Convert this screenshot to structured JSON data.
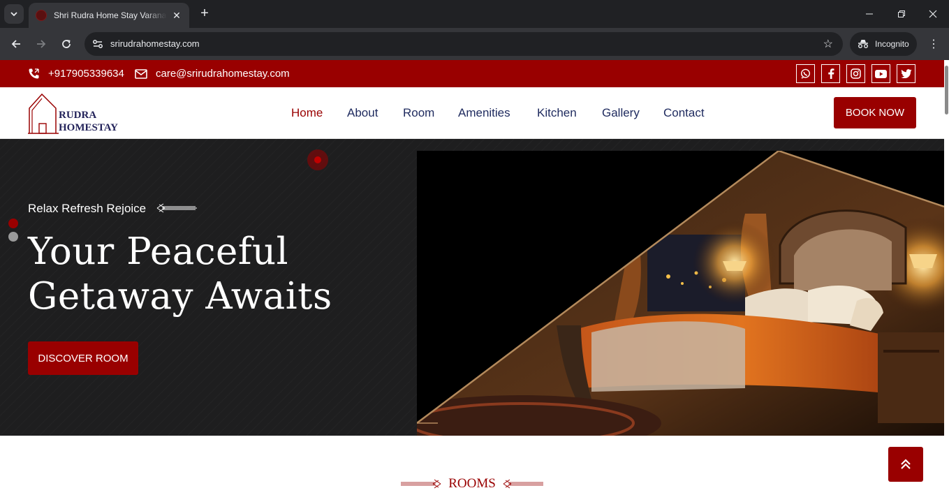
{
  "browser": {
    "tab_title": "Shri Rudra Home Stay Varanasi",
    "url": "srirudrahomestay.com",
    "incognito_label": "Incognito"
  },
  "topbar": {
    "phone": "+917905339634",
    "email": "care@srirudrahomestay.com",
    "social": [
      "whatsapp-icon",
      "facebook-icon",
      "instagram-icon",
      "youtube-icon",
      "twitter-icon"
    ]
  },
  "logo": {
    "line1": "RUDRA",
    "line2": "HOMESTAY"
  },
  "nav": {
    "items": [
      "Home",
      "About",
      "Room",
      "Amenities",
      "Kitchen",
      "Gallery",
      "Contact"
    ],
    "active": "Home",
    "book_label": "BOOK NOW"
  },
  "hero": {
    "tagline": "Relax Refresh Rejoice",
    "headline_line1": "Your Peaceful",
    "headline_line2": "Getaway Awaits",
    "cta_label": "DISCOVER ROOM"
  },
  "rooms": {
    "title": "ROOMS"
  },
  "colors": {
    "brand": "#990000",
    "nav_text": "#1e2a5e",
    "hero_bg": "#1e1e1f"
  }
}
